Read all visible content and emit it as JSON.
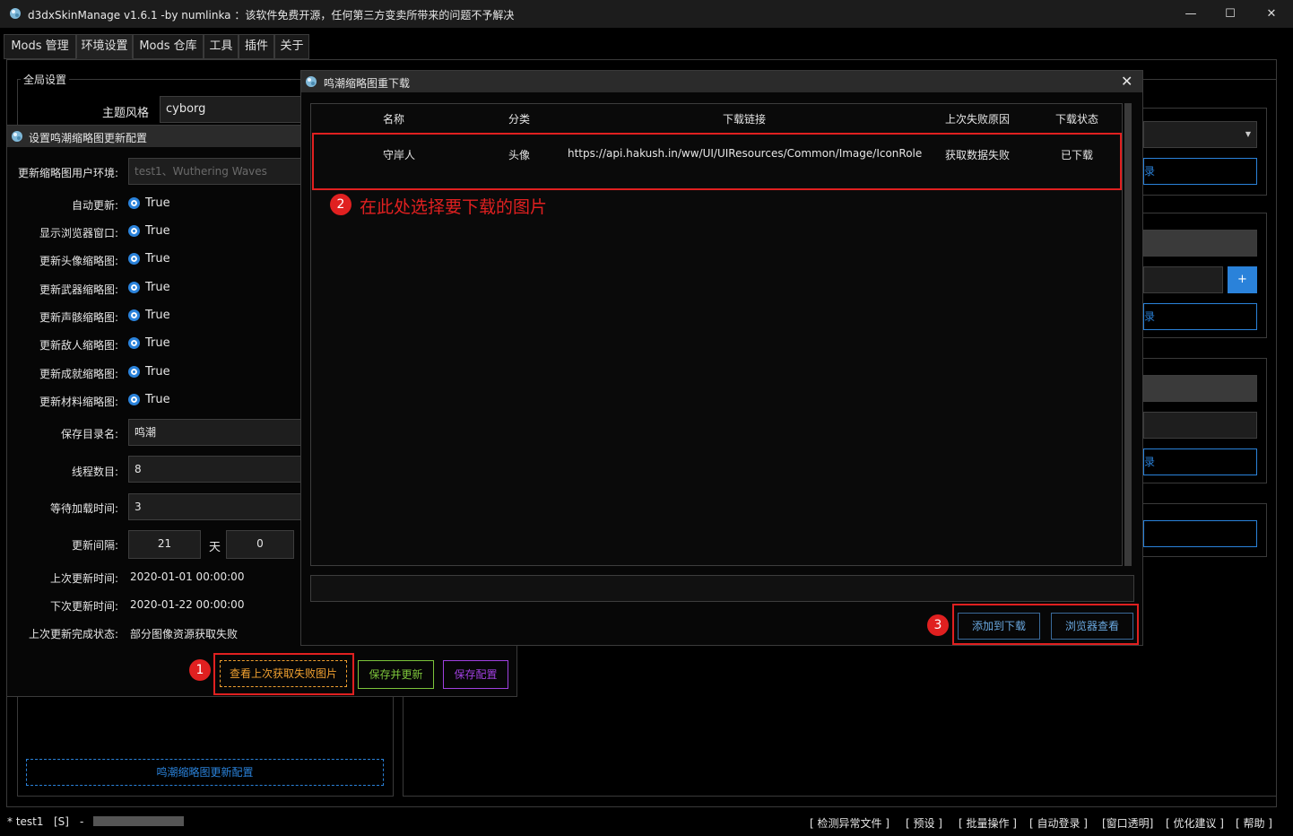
{
  "window": {
    "title": "d3dxSkinManage v1.6.1 -by numlinka ：该软件免费开源，任何第三方变卖所带来的问题不予解决",
    "minimize": "—",
    "maximize": "☐",
    "close": "✕"
  },
  "tabs": [
    "Mods 管理",
    "环境设置",
    "Mods 仓库",
    "工具",
    "插件",
    "关于"
  ],
  "global_settings": {
    "title": "全局设置",
    "theme_label": "主题风格",
    "theme_value": "cyborg"
  },
  "background_panel": {
    "browse_fragment": "录",
    "add_symbol": "+",
    "config_button": "鸣潮缩略图更新配置"
  },
  "config_dialog": {
    "title": "设置鸣潮缩略图更新配置",
    "fields": [
      {
        "label": "更新缩略图用户环境:",
        "value": "test1、Wuthering Waves"
      }
    ],
    "toggles": [
      {
        "label": "自动更新:",
        "value": "True"
      },
      {
        "label": "显示浏览器窗口:",
        "value": "True"
      },
      {
        "label": "更新头像缩略图:",
        "value": "True"
      },
      {
        "label": "更新武器缩略图:",
        "value": "True"
      },
      {
        "label": "更新声骸缩略图:",
        "value": "True"
      },
      {
        "label": "更新敌人缩略图:",
        "value": "True"
      },
      {
        "label": "更新成就缩略图:",
        "value": "True"
      },
      {
        "label": "更新材料缩略图:",
        "value": "True"
      }
    ],
    "save_dir_label": "保存目录名:",
    "save_dir_value": "鸣潮",
    "threads_label": "线程数目:",
    "threads_value": "8",
    "wait_label": "等待加载时间:",
    "wait_value": "3",
    "interval_label": "更新间隔:",
    "interval_days": "21",
    "interval_unit": "天",
    "interval_extra": "0",
    "last_update_label": "上次更新时间:",
    "last_update_value": "2020-01-01 00:00:00",
    "next_update_label": "下次更新时间:",
    "next_update_value": "2020-01-22 00:00:00",
    "last_status_label": "上次更新完成状态:",
    "last_status_value": "部分图像资源获取失败",
    "btn_view_failed": "查看上次获取失败图片",
    "btn_save_update": "保存并更新",
    "btn_save_config": "保存配置",
    "colors": {
      "orange": "#f0a030",
      "green": "#7cc43a",
      "purple": "#a040e0"
    }
  },
  "download_dialog": {
    "title": "鸣潮缩略图重下载",
    "columns": [
      "名称",
      "分类",
      "下载链接",
      "上次失败原因",
      "下载状态"
    ],
    "rows": [
      {
        "name": "守岸人",
        "category": "头像",
        "url": "https://api.hakush.in/ww/UI/UIResources/Common/Image/IconRole",
        "reason": "获取数据失败",
        "status": "已下载"
      }
    ],
    "btn_add": "添加到下载",
    "btn_browser": "浏览器查看"
  },
  "annotations": {
    "badge1": "1",
    "badge2": "2",
    "badge3": "3",
    "note2": "在此处选择要下载的图片"
  },
  "statusbar": {
    "env": "* test1",
    "flag": "[S]",
    "sep": "-",
    "links": [
      "[ 检测异常文件 ]",
      "[ 预设 ]",
      "[ 批量操作 ]",
      "[ 自动登录 ]",
      "[窗口透明]",
      "[ 优化建议 ]",
      "[ 帮助 ]"
    ]
  }
}
